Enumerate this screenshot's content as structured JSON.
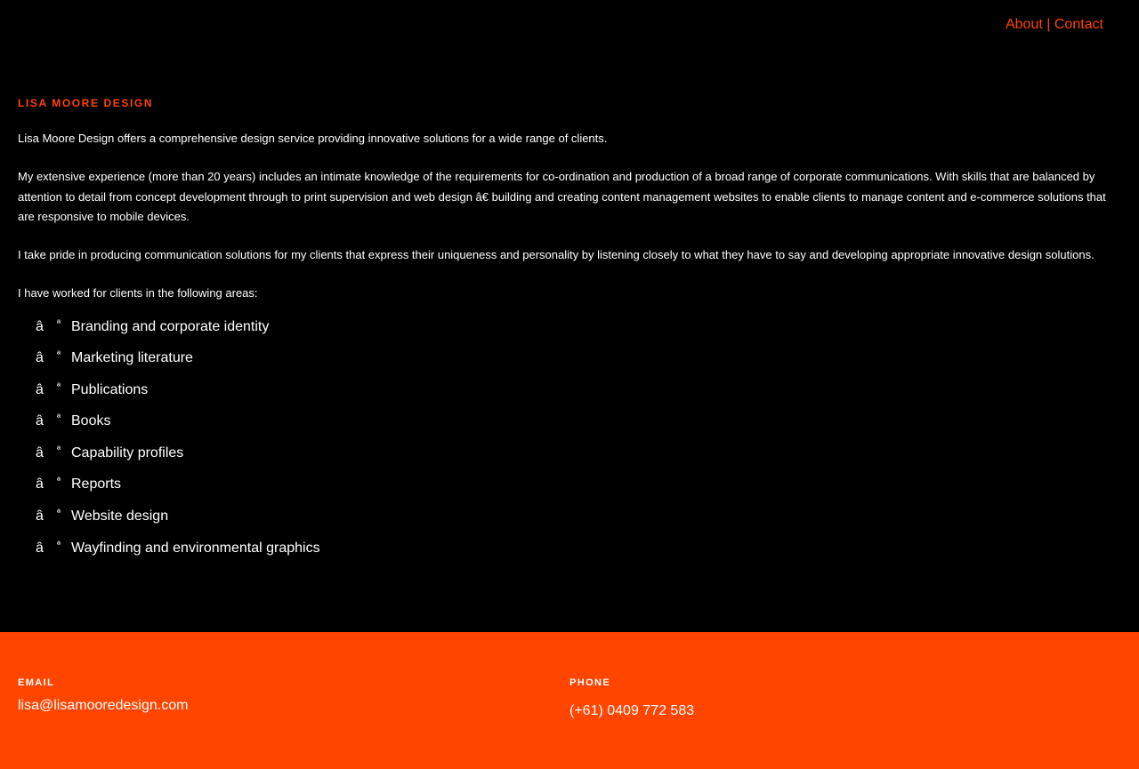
{
  "nav": {
    "about_label": "About",
    "separator": "|",
    "contact_label": "Contact"
  },
  "main": {
    "brand": "LISA MOORE DESIGN",
    "paragraphs": [
      "Lisa Moore Design offers a comprehensive design service providing innovative solutions for a wide range of clients.",
      "My extensive experience (more than 20 years) includes an intimate knowledge of the requirements for co-ordination and production of a broad range of corporate communications. With skills that are balanced by attention to detail from concept development through to print supervision and web design â€   building and creating content management websites to enable clients to manage content and e-commerce solutions that are responsive to mobile devices.",
      "I take pride in producing communication solutions for my clients that express their uniqueness and personality by listening closely to what they have to say and developing appropriate innovative design solutions.",
      "I have worked for clients in the following areas:"
    ],
    "bullet_glyph_1": "â",
    "bullet_glyph_2": "ª",
    "areas": [
      "Branding and corporate identity",
      "Marketing literature",
      "Publications",
      "Books",
      "Capability profiles",
      "Reports",
      "Website design",
      "Wayfinding and environmental graphics"
    ]
  },
  "footer": {
    "email_label": "EMAIL",
    "email_value": "lisa@lisamooredesign.com",
    "phone_label": "PHONE",
    "phone_value": "(+61) 0409 772 583"
  },
  "colors": {
    "background": "#000000",
    "accent": "#ff4500",
    "text": "#ffffff"
  }
}
